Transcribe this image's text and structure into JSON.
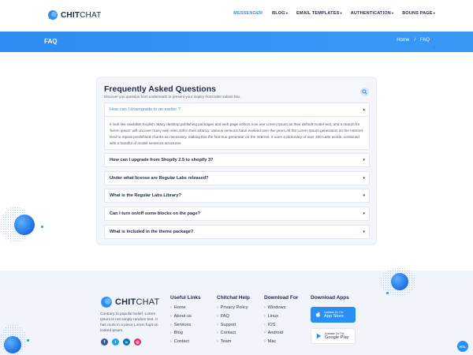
{
  "brand": {
    "name_bold": "CHIT",
    "name_light": "CHAT",
    "accent": "#2b8ef3"
  },
  "nav": [
    {
      "label": "MESSENGER",
      "caret": ""
    },
    {
      "label": "BLOG",
      "caret": "▾"
    },
    {
      "label": "EMAIL TEMPLATES",
      "caret": "▾"
    },
    {
      "label": "AUTHENTICATION",
      "caret": "▾"
    },
    {
      "label": "BOUNS PAGE",
      "caret": "▾"
    }
  ],
  "banner": {
    "title": "FAQ",
    "crumb_home": "Home",
    "crumb_sep": "/",
    "crumb_current": "FAQ"
  },
  "faq": {
    "title": "Frequently Asked Questions",
    "subtitle": "Discover you question from underneath or present your inquiry frontl tahe submit box.",
    "items": [
      {
        "question": "How can I downgrade to an earlier ?",
        "caret": "▴"
      },
      {
        "question": "How can I upgrade from Shopify 2.5 to shopify 3?",
        "caret": "▾"
      },
      {
        "question": "Under what license are Regular Labs released?",
        "caret": "▾"
      },
      {
        "question": "What is the Regular Labs Library?",
        "caret": "▾"
      },
      {
        "question": "Can I turn on/off some blocks on the page?",
        "caret": "▾"
      },
      {
        "question": "What is included in the theme package?",
        "caret": "▾"
      }
    ],
    "answer": "it look like readable English. Many desktop publishing packages and web page editors now use Lorem Ipsum as their default model text, and a search for 'lorem ipsum' will uncover many web sites still in their infancy. Various versions have evolved over the years,All the Lorem Ipsum generators on the Internet tend to repeat predefined chunks as necessary, making this the first true generator on the Internet. It uses a dictionary of over 200 Latin words, combined with a handful of model sentence structures"
  },
  "footer": {
    "about": "Contrary to popular belief, Lorem Ipsum is not simply random text. It has roots in a piece Lorem fugit on looked ipsum.",
    "social": [
      {
        "icon": "facebook-icon",
        "glyph": "f",
        "color": "#3b5998"
      },
      {
        "icon": "twitter-icon",
        "glyph": "t",
        "color": "#1da1f2"
      },
      {
        "icon": "linkedin-icon",
        "glyph": "in",
        "color": "#0e76a8"
      },
      {
        "icon": "instagram-icon",
        "glyph": "◎",
        "color": "#e1306c"
      }
    ],
    "columns": [
      {
        "heading": "Useful Links",
        "links": [
          "Home",
          "About us",
          "Services",
          "Blog",
          "Contact"
        ]
      },
      {
        "heading": "Chitchat Help",
        "links": [
          "Privacy Policy",
          "FAQ",
          "Support",
          "Contact",
          "Team"
        ]
      },
      {
        "heading": "Download For",
        "links": [
          "Windows",
          "Linux",
          "IOS",
          "Android",
          "Mac"
        ]
      }
    ],
    "apps": {
      "heading": "Download Apps",
      "apple_small": "Available On The",
      "apple_big": "App Store",
      "google_small": "Available On The",
      "google_big": "Google Play"
    }
  },
  "chat_bubble": "RTL"
}
